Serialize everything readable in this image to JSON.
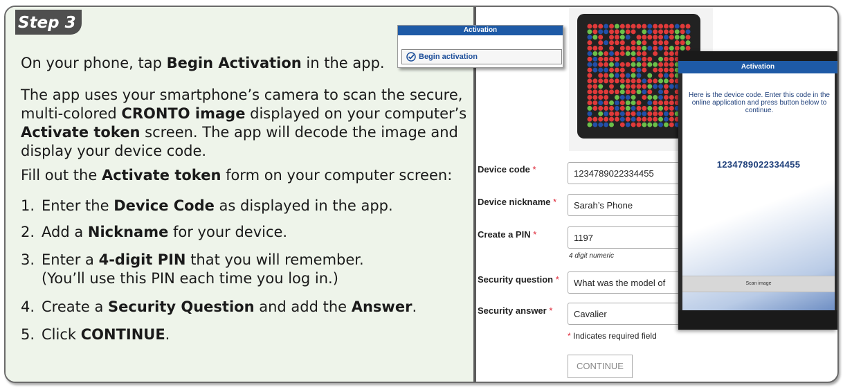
{
  "step_tab": "Step 3",
  "instructions": {
    "p1": {
      "a": "On your phone, tap ",
      "b": "Begin Activation",
      "c": " in the app."
    },
    "p2": {
      "l1": "The app uses your smartphone’s camera to scan the secure,",
      "l2a": "multi-colored ",
      "l2b": "CRONTO image",
      "l2c": " displayed on your computer’s",
      "l3b": "Activate token",
      "l3c": " screen. The app will decode the image and",
      "l4": "display your device code."
    },
    "p3": {
      "a": "Fill out the ",
      "b": "Activate token",
      "c": " form on your computer screen:"
    },
    "steps": [
      {
        "num": "1.",
        "a": "Enter the ",
        "b": "Device Code",
        "c": " as displayed in the app."
      },
      {
        "num": "2.",
        "a": "Add a ",
        "b": "Nickname",
        "c": " for your device."
      },
      {
        "num": "3.",
        "a": "Enter a ",
        "b": "4-digit PIN",
        "c": " that you will remember.",
        "sub": "(You’ll use this PIN each time you log in.)"
      },
      {
        "num": "4.",
        "a": "Create a ",
        "b": "Security Question",
        "c": " and add the ",
        "d": "Answer",
        "e": "."
      },
      {
        "num": "5.",
        "a": "Click ",
        "b": "CONTINUE",
        "c": "."
      }
    ]
  },
  "inset": {
    "header": "Activation",
    "button": "Begin activation"
  },
  "form": {
    "required_mark": "*",
    "device_code_label": "Device code",
    "device_code_value": "1234789022334455",
    "nickname_label": "Device nickname",
    "nickname_value": "Sarah’s Phone",
    "pin_label": "Create a PIN",
    "pin_value": "1197",
    "pin_hint": "4 digit numeric",
    "question_label": "Security question",
    "question_value": "What was the model of",
    "answer_label": "Security answer",
    "answer_value": "Cavalier",
    "required_note": "Indicates required field",
    "continue_label": "CONTINUE"
  },
  "phone": {
    "header": "Activation",
    "message": "Here is the device code. Enter this code in the online application and press button below to continue.",
    "code": "1234789022334455",
    "scan_button": "Scan image"
  },
  "colors": {
    "tab_bg": "#4f4f4f",
    "left_panel_bg": "#eef4ea",
    "accent_blue": "#1e5aa6",
    "required_red": "#dd2233",
    "cronto_red": "#e03a3a",
    "cronto_green": "#6cc04a",
    "cronto_blue": "#2350a8"
  }
}
